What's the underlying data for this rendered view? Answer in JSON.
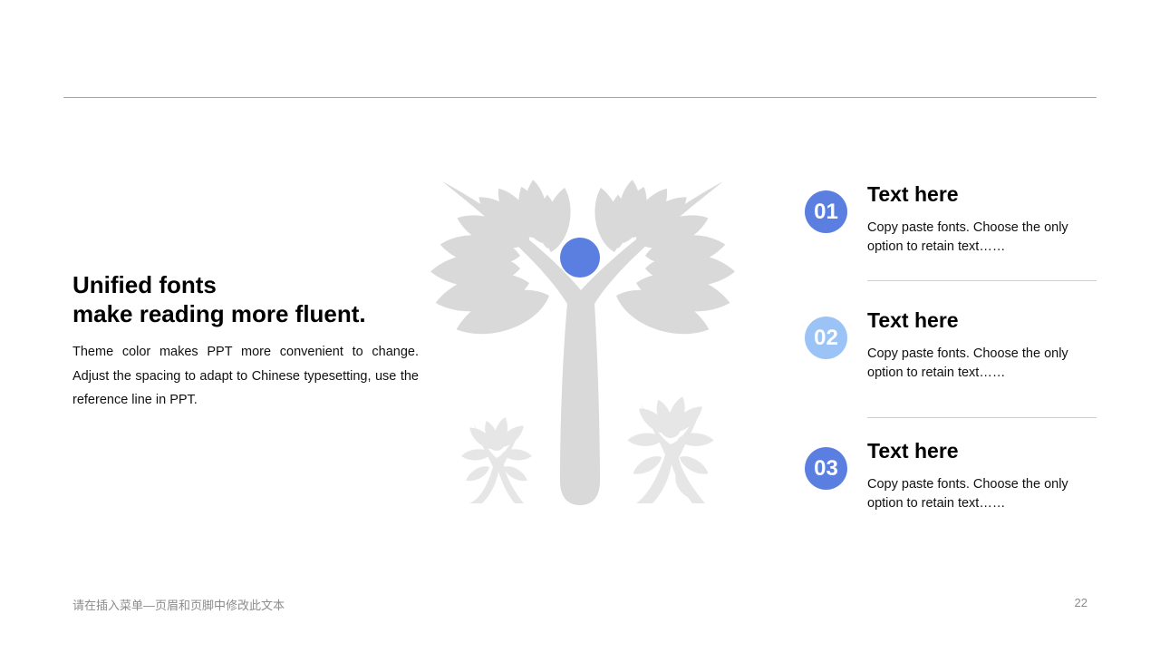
{
  "headline": {
    "line1": "Unified fonts",
    "line2": "make reading more fluent."
  },
  "body_text": "Theme color makes PPT more convenient to change. Adjust the spacing to adapt to Chinese typesetting, use the reference line in PPT.",
  "illustration": {
    "icon": "tree-people-icon",
    "leaf_color": "#d9d9d9",
    "dot_color": "#5a7fe0"
  },
  "items": [
    {
      "number": "01",
      "title": "Text here",
      "desc": "Copy paste fonts. Choose the only option to retain text……",
      "color": "#5a7fe0"
    },
    {
      "number": "02",
      "title": "Text here",
      "desc": "Copy paste fonts. Choose the only option to retain text……",
      "color": "#9cc3f5"
    },
    {
      "number": "03",
      "title": "Text here",
      "desc": "Copy paste fonts. Choose the only option to retain text……",
      "color": "#5a7fe0"
    }
  ],
  "footer": {
    "text": "请在插入菜单—页眉和页脚中修改此文本",
    "page_number": "22"
  }
}
